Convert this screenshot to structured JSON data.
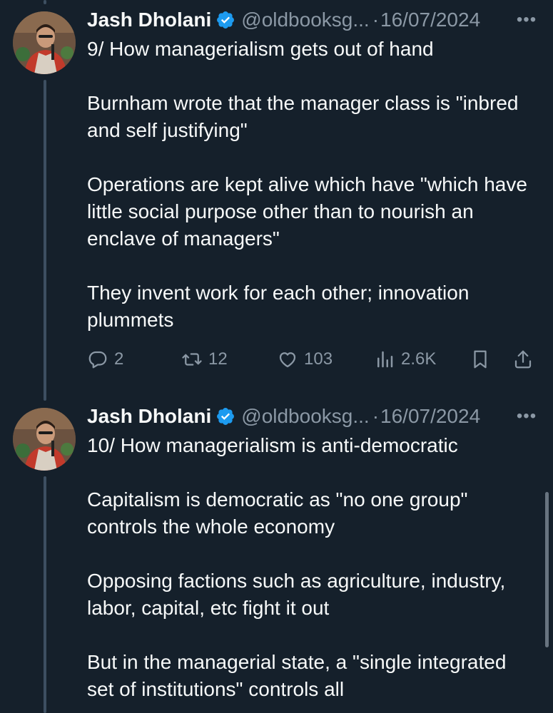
{
  "tweets": [
    {
      "author": {
        "name": "Jash Dholani",
        "handle": "@oldbooksg...",
        "separator": "·",
        "date": "16/07/2024"
      },
      "paragraphs": [
        "9/ How managerialism gets out of hand",
        "Burnham wrote that the manager class is \"inbred and self justifying\"",
        "Operations are kept alive which have \"which have little social purpose other than to nourish an enclave of managers\"",
        "They invent work for each other; innovation plummets"
      ],
      "metrics": {
        "replies": "2",
        "reposts": "12",
        "likes": "103",
        "views": "2.6K"
      }
    },
    {
      "author": {
        "name": "Jash Dholani",
        "handle": "@oldbooksg...",
        "separator": "·",
        "date": "16/07/2024"
      },
      "paragraphs": [
        "10/ How managerialism is anti-democratic",
        "Capitalism is democratic as \"no one group\" controls the whole economy",
        "Opposing factions such as agriculture, industry, labor, capital, etc fight it out",
        "But in the managerial state, a \"single integrated set of institutions\" controls all"
      ]
    }
  ],
  "colors": {
    "background": "#15202b",
    "text": "#f7f9f9",
    "secondary": "#8b98a5",
    "verified": "#1d9bf0",
    "thread_line": "#3d4f61"
  },
  "icons": {
    "verified": "verified-badge-icon",
    "more": "more-dots-icon",
    "reply": "reply-icon",
    "repost": "repost-icon",
    "like": "heart-icon",
    "views": "views-chart-icon",
    "bookmark": "bookmark-icon",
    "share": "share-icon"
  }
}
